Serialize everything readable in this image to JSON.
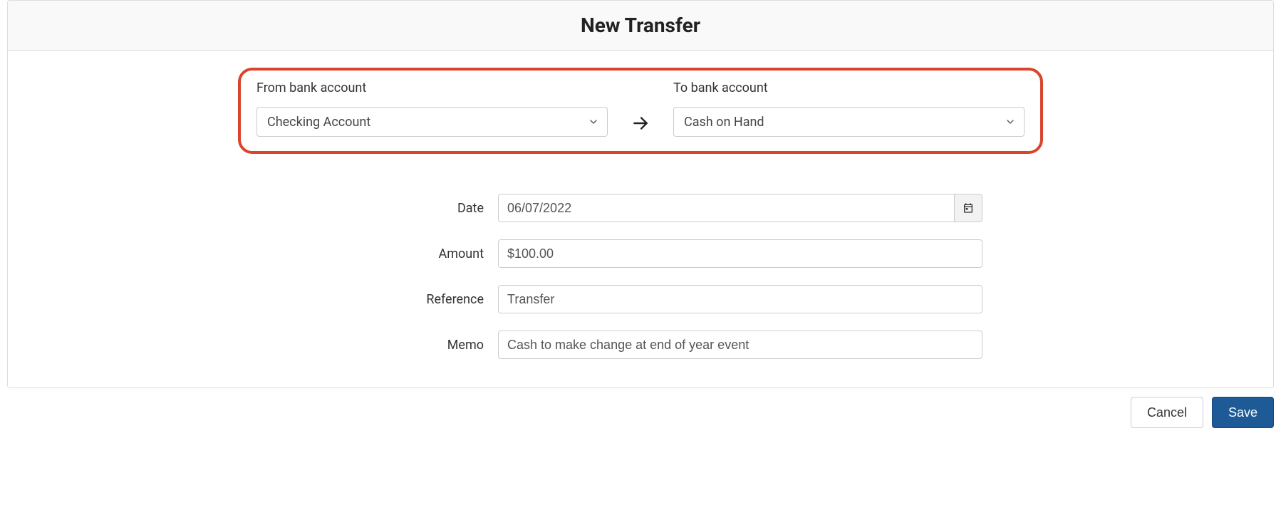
{
  "header": {
    "title": "New Transfer"
  },
  "accounts": {
    "from_label": "From bank account",
    "from_value": "Checking Account",
    "to_label": "To bank account",
    "to_value": "Cash on Hand"
  },
  "fields": {
    "date_label": "Date",
    "date_value": "06/07/2022",
    "amount_label": "Amount",
    "amount_value": "$100.00",
    "reference_label": "Reference",
    "reference_value": "Transfer",
    "memo_label": "Memo",
    "memo_value": "Cash to make change at end of year event"
  },
  "buttons": {
    "cancel": "Cancel",
    "save": "Save"
  }
}
